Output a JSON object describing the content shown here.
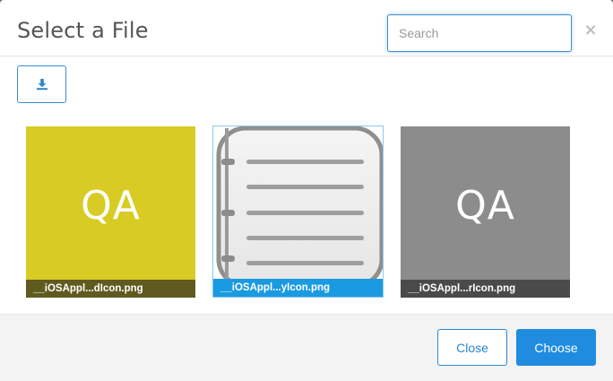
{
  "modal": {
    "title": "Select a File",
    "close_glyph": "×"
  },
  "search": {
    "placeholder": "Search",
    "value": ""
  },
  "toolbar": {
    "upload_icon": "upload-icon"
  },
  "files": [
    {
      "name": "__iOSAppl...dIcon.png",
      "art_text": "QA",
      "background": "#d8cb24",
      "label_bg": "#5f5a1f",
      "selected": false
    },
    {
      "name": "__iOSAppl...yIcon.png",
      "art_icon": "notes-icon",
      "background": "#ffffff",
      "label_bg": "#1a9ae0",
      "selected": true
    },
    {
      "name": "__iOSAppl...rIcon.png",
      "art_text": "QA",
      "background": "#8c8c8c",
      "label_bg": "#4a4a4a",
      "selected": false
    }
  ],
  "footer": {
    "close_label": "Close",
    "choose_label": "Choose"
  },
  "colors": {
    "accent": "#1f8ce0",
    "title_text": "#555555"
  }
}
